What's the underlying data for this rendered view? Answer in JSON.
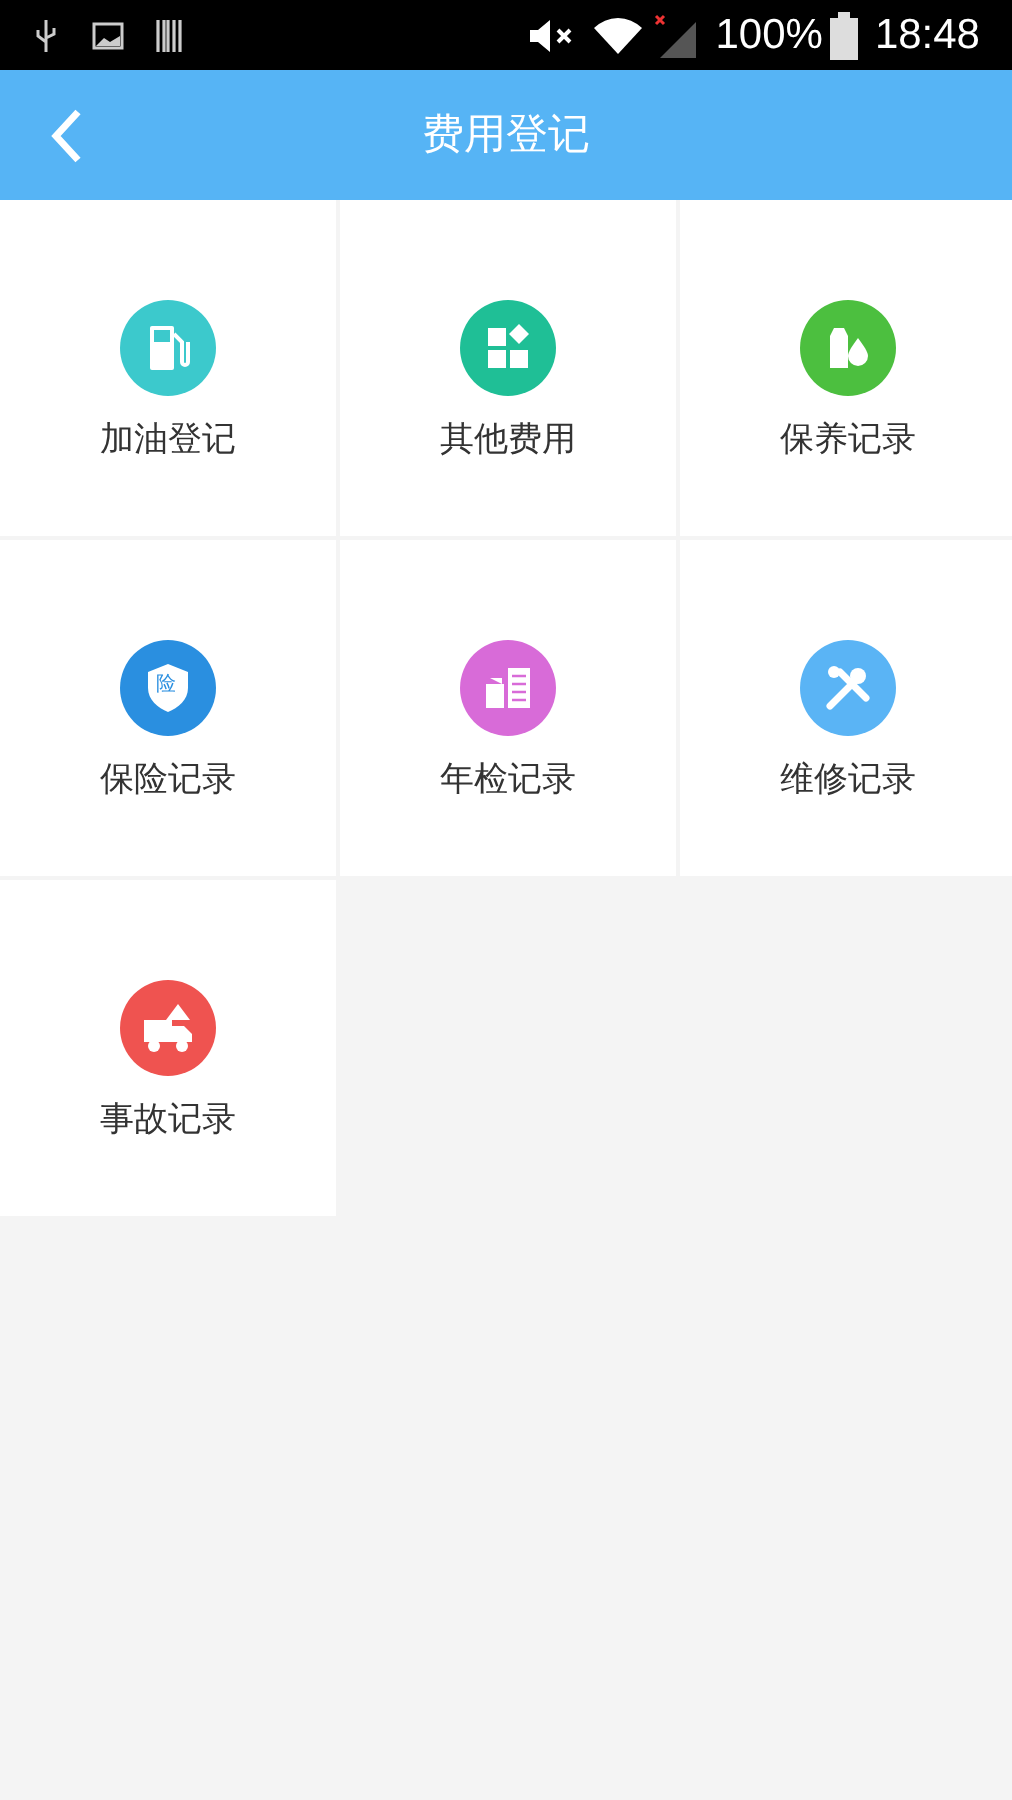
{
  "status_bar": {
    "battery_text": "100%",
    "time": "18:48"
  },
  "header": {
    "title": "费用登记"
  },
  "items": [
    {
      "label": "加油登记",
      "kind": "fuel",
      "color": "#3cc9cc"
    },
    {
      "label": "其他费用",
      "kind": "blocks",
      "color": "#1fbf96"
    },
    {
      "label": "保养记录",
      "kind": "oil",
      "color": "#4cbf3f"
    },
    {
      "label": "保险记录",
      "kind": "shield",
      "color": "#2a8fe0",
      "badge": "险"
    },
    {
      "label": "年检记录",
      "kind": "inspect",
      "color": "#d86bd8"
    },
    {
      "label": "维修记录",
      "kind": "tools",
      "color": "#5ab4f5"
    },
    {
      "label": "事故记录",
      "kind": "truck",
      "color": "#ef5350"
    }
  ]
}
